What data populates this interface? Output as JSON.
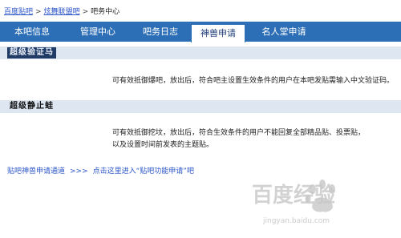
{
  "breadcrumb": {
    "items": [
      "百度贴吧",
      "炫舞联盟吧",
      "吧务中心"
    ],
    "separator": ">"
  },
  "tabs": [
    {
      "label": "本吧信息",
      "active": false
    },
    {
      "label": "管理中心",
      "active": false
    },
    {
      "label": "吧务日志",
      "active": false
    },
    {
      "label": "神兽申请",
      "active": true
    },
    {
      "label": "名人堂申请",
      "active": false
    }
  ],
  "sections": [
    {
      "title": "超级验证马",
      "description_lines": [
        "可有效抵御爆吧，放出后，符合吧主设置生效条件的用户在本吧发贴需输入中文验证码。"
      ]
    },
    {
      "title": "超级静止蛙",
      "description_lines": [
        "可有效抵御挖坟，放出后，符合生效条件的用户不能回复全部精品贴、投票贴，",
        "以及设置时间前发表的主题贴。"
      ]
    }
  ],
  "footer": {
    "link1": "贴吧神兽申请通道",
    "arrows": ">>>",
    "link2": "点击这里进入“贴吧功能申请”吧"
  },
  "watermark": {
    "text": "百度经验",
    "url": "jingyan.baidu.com"
  },
  "colors": {
    "tab_bar": "#2d6fb6",
    "section_header": "#dde6f1",
    "link": "#2b55c8"
  }
}
